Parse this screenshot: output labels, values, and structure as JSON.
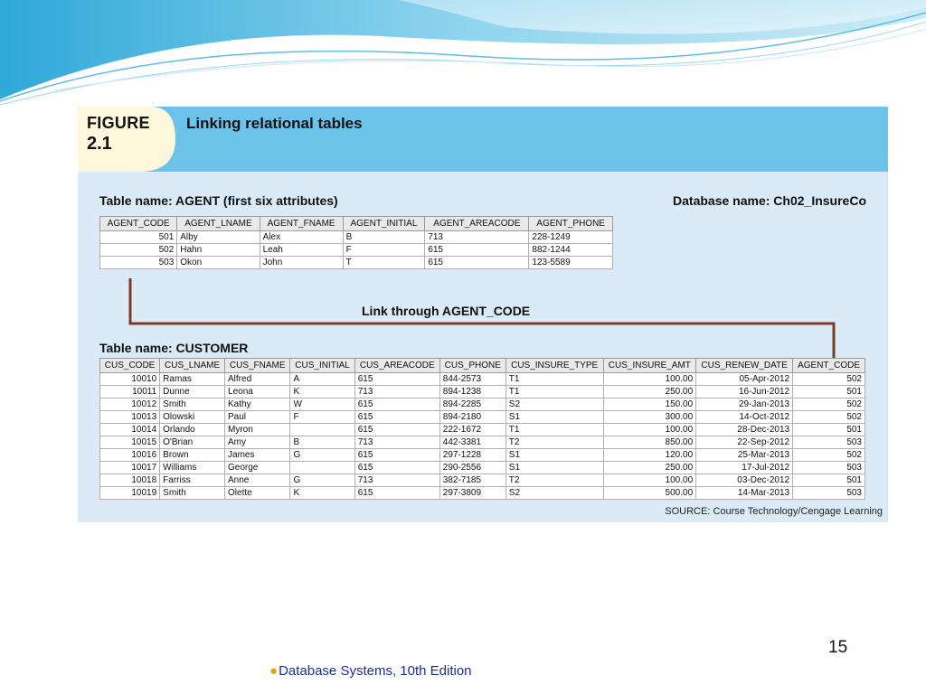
{
  "figure": {
    "label_line1": "FIGURE",
    "label_line2": "2.1",
    "title": "Linking relational tables",
    "agent_caption": "Table name: AGENT (first six attributes)",
    "database_caption": "Database name: Ch02_InsureCo",
    "link_label": "Link through AGENT_CODE",
    "customer_caption": "Table name: CUSTOMER",
    "source": "SOURCE: Course Technology/Cengage Learning",
    "colors": {
      "header": "#6cc3ea",
      "panel": "#daeaf6",
      "label": "#fdf7dc",
      "link_line": "#7a3a25"
    }
  },
  "agent_table": {
    "columns": [
      "AGENT_CODE",
      "AGENT_LNAME",
      "AGENT_FNAME",
      "AGENT_INITIAL",
      "AGENT_AREACODE",
      "AGENT_PHONE"
    ],
    "rows": [
      [
        "501",
        "Alby",
        "Alex",
        "B",
        "713",
        "228-1249"
      ],
      [
        "502",
        "Hahn",
        "Leah",
        "F",
        "615",
        "882-1244"
      ],
      [
        "503",
        "Okon",
        "John",
        "T",
        "615",
        "123-5589"
      ]
    ]
  },
  "customer_table": {
    "columns": [
      "CUS_CODE",
      "CUS_LNAME",
      "CUS_FNAME",
      "CUS_INITIAL",
      "CUS_AREACODE",
      "CUS_PHONE",
      "CUS_INSURE_TYPE",
      "CUS_INSURE_AMT",
      "CUS_RENEW_DATE",
      "AGENT_CODE"
    ],
    "rows": [
      [
        "10010",
        "Ramas",
        "Alfred",
        "A",
        "615",
        "844-2573",
        "T1",
        "100.00",
        "05-Apr-2012",
        "502"
      ],
      [
        "10011",
        "Dunne",
        "Leona",
        "K",
        "713",
        "894-1238",
        "T1",
        "250.00",
        "16-Jun-2012",
        "501"
      ],
      [
        "10012",
        "Smith",
        "Kathy",
        "W",
        "615",
        "894-2285",
        "S2",
        "150.00",
        "29-Jan-2013",
        "502"
      ],
      [
        "10013",
        "Olowski",
        "Paul",
        "F",
        "615",
        "894-2180",
        "S1",
        "300.00",
        "14-Oct-2012",
        "502"
      ],
      [
        "10014",
        "Orlando",
        "Myron",
        "",
        "615",
        "222-1672",
        "T1",
        "100.00",
        "28-Dec-2013",
        "501"
      ],
      [
        "10015",
        "O'Brian",
        "Amy",
        "B",
        "713",
        "442-3381",
        "T2",
        "850.00",
        "22-Sep-2012",
        "503"
      ],
      [
        "10016",
        "Brown",
        "James",
        "G",
        "615",
        "297-1228",
        "S1",
        "120.00",
        "25-Mar-2013",
        "502"
      ],
      [
        "10017",
        "Williams",
        "George",
        "",
        "615",
        "290-2556",
        "S1",
        "250.00",
        "17-Jul-2012",
        "503"
      ],
      [
        "10018",
        "Farriss",
        "Anne",
        "G",
        "713",
        "382-7185",
        "T2",
        "100.00",
        "03-Dec-2012",
        "501"
      ],
      [
        "10019",
        "Smith",
        "Olette",
        "K",
        "615",
        "297-3809",
        "S2",
        "500.00",
        "14-Mar-2013",
        "503"
      ]
    ]
  },
  "slide": {
    "page_number": "15",
    "footer": "Database Systems, 10th Edition",
    "bullet": "●"
  }
}
